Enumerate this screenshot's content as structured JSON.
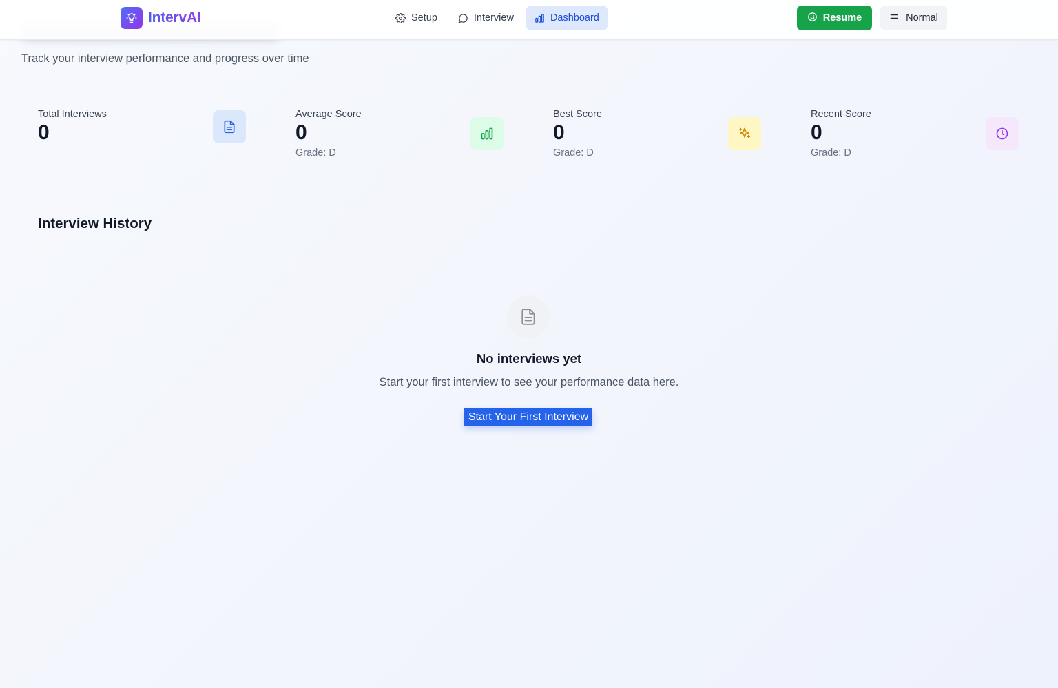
{
  "app": {
    "name": "IntervAI"
  },
  "nav": {
    "items": [
      {
        "label": "Setup",
        "icon": "gear-icon"
      },
      {
        "label": "Interview",
        "icon": "chat-bubble-icon"
      },
      {
        "label": "Dashboard",
        "icon": "bar-chart-icon",
        "active": true
      }
    ]
  },
  "actions": {
    "resume_label": "Resume",
    "mode_label": "Normal"
  },
  "page": {
    "subtitle": "Track your interview performance and progress over time"
  },
  "stats": [
    {
      "label": "Total Interviews",
      "value": "0",
      "grade": "",
      "icon": "document-icon",
      "icon_bg": "#dbe8fc",
      "icon_color": "#2563eb"
    },
    {
      "label": "Average Score",
      "value": "0",
      "grade": "Grade: D",
      "icon": "bar-chart-icon",
      "icon_bg": "#dcfce7",
      "icon_color": "#16a34a"
    },
    {
      "label": "Best Score",
      "value": "0",
      "grade": "Grade: D",
      "icon": "sparkle-icon",
      "icon_bg": "#fef6c3",
      "icon_color": "#ca8a04"
    },
    {
      "label": "Recent Score",
      "value": "0",
      "grade": "Grade: D",
      "icon": "clock-icon",
      "icon_bg": "#f5e8fd",
      "icon_color": "#9333ea"
    }
  ],
  "history": {
    "title": "Interview History",
    "empty_title": "No interviews yet",
    "empty_text": "Start your first interview to see your performance data here.",
    "start_label": "Start Your First Interview"
  },
  "colors": {
    "primary": "#2563eb",
    "success": "#16a34a",
    "brand_gradient_start": "#4f6ef7",
    "brand_gradient_end": "#9333ea"
  }
}
